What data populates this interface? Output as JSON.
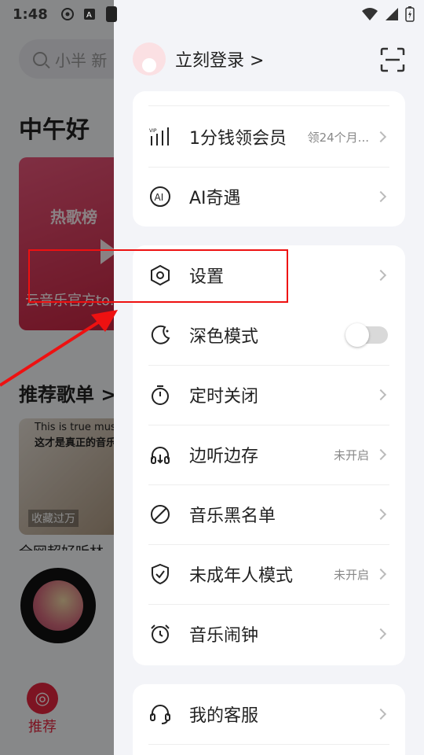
{
  "status": {
    "time": "1:48"
  },
  "bg": {
    "search_placeholder": "小半 新",
    "greeting": "中午好",
    "hot_title": "热歌榜",
    "hot_sub": "云音乐官方to...",
    "rec_title": "推荐歌单 >",
    "cat_caption1": "This is true music",
    "cat_caption2": "这才是真正的音乐",
    "cat_fav": "收藏过万",
    "song_line": "全网超好听林",
    "tab_home_label": "推荐"
  },
  "drawer": {
    "login_text": "立刻登录 >",
    "card1": [
      {
        "label": "1分钱领会员",
        "sub": "领24个月...",
        "icon": "vip-bars-icon"
      },
      {
        "label": "AI奇遇",
        "sub": "",
        "icon": "ai-icon"
      }
    ],
    "card2": [
      {
        "label": "设置",
        "sub": "",
        "icon": "settings-hexagon-icon"
      },
      {
        "label": "深色模式",
        "sub": "",
        "icon": "moon-icon"
      },
      {
        "label": "定时关闭",
        "sub": "",
        "icon": "timer-icon"
      },
      {
        "label": "边听边存",
        "sub": "未开启",
        "icon": "headphone-download-icon"
      },
      {
        "label": "音乐黑名单",
        "sub": "",
        "icon": "block-icon"
      },
      {
        "label": "未成年人模式",
        "sub": "未开启",
        "icon": "shield-check-icon"
      },
      {
        "label": "音乐闹钟",
        "sub": "",
        "icon": "alarm-icon"
      }
    ],
    "card3": [
      {
        "label": "我的客服",
        "sub": "",
        "icon": "headset-icon"
      }
    ]
  }
}
